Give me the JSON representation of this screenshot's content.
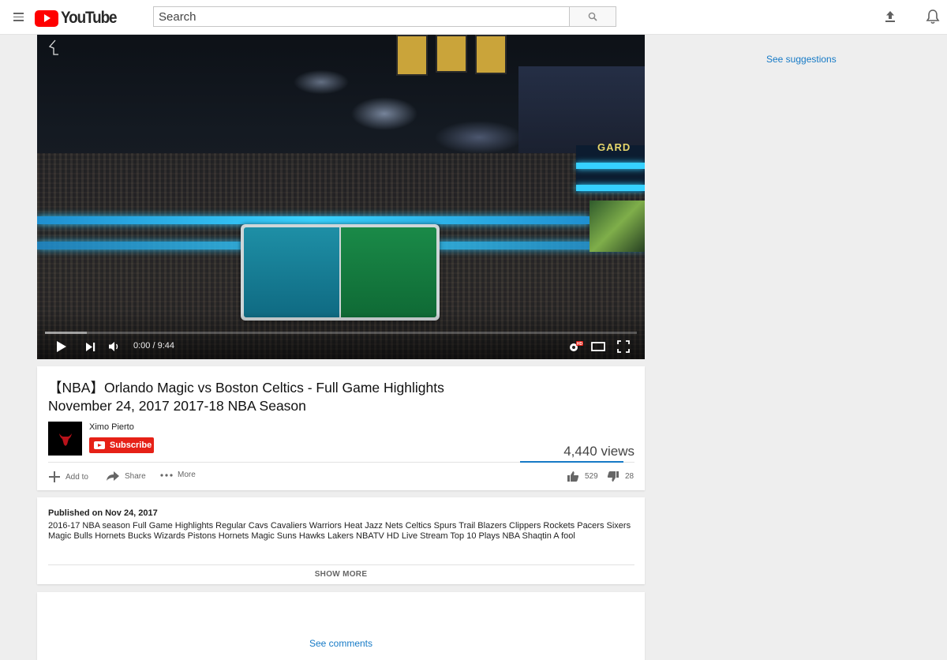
{
  "masthead": {
    "brand": "YouTube",
    "search_placeholder": "Search"
  },
  "player": {
    "arena_sign": "GARD",
    "time_display": "0:00 / 9:44",
    "hd_badge": "HD",
    "progress_loaded_fraction": 0.07
  },
  "video": {
    "title": "【NBA】Orlando Magic vs Boston Celtics - Full Game Highlights November 24, 2017 2017-18 NBA Season",
    "channel": "Ximo Pierto",
    "subscribe_label": "Subscribe",
    "views": "4,440 views",
    "actions": {
      "add_to": "Add to",
      "share": "Share",
      "more": "More"
    },
    "likes": "529",
    "dislikes": "28",
    "like_ratio": 0.95
  },
  "description": {
    "published": "Published on Nov 24, 2017",
    "text": "2016-17 NBA season Full Game Highlights Regular Cavs Cavaliers Warriors Heat Jazz Nets Celtics Spurs Trail Blazers Clippers Rockets Pacers Sixers Magic Bulls Hornets Bucks Wizards Pistons Hornets Magic Suns Hawks Lakers NBATV HD Live Stream Top 10 Plays NBA Shaqtin A fool",
    "show_more": "SHOW MORE"
  },
  "comments": {
    "link": "See comments"
  },
  "sidebar": {
    "suggestions_link": "See suggestions"
  },
  "colors": {
    "brand_red": "#ff0000",
    "subscribe_red": "#e62117",
    "link_blue": "#167ac6"
  }
}
